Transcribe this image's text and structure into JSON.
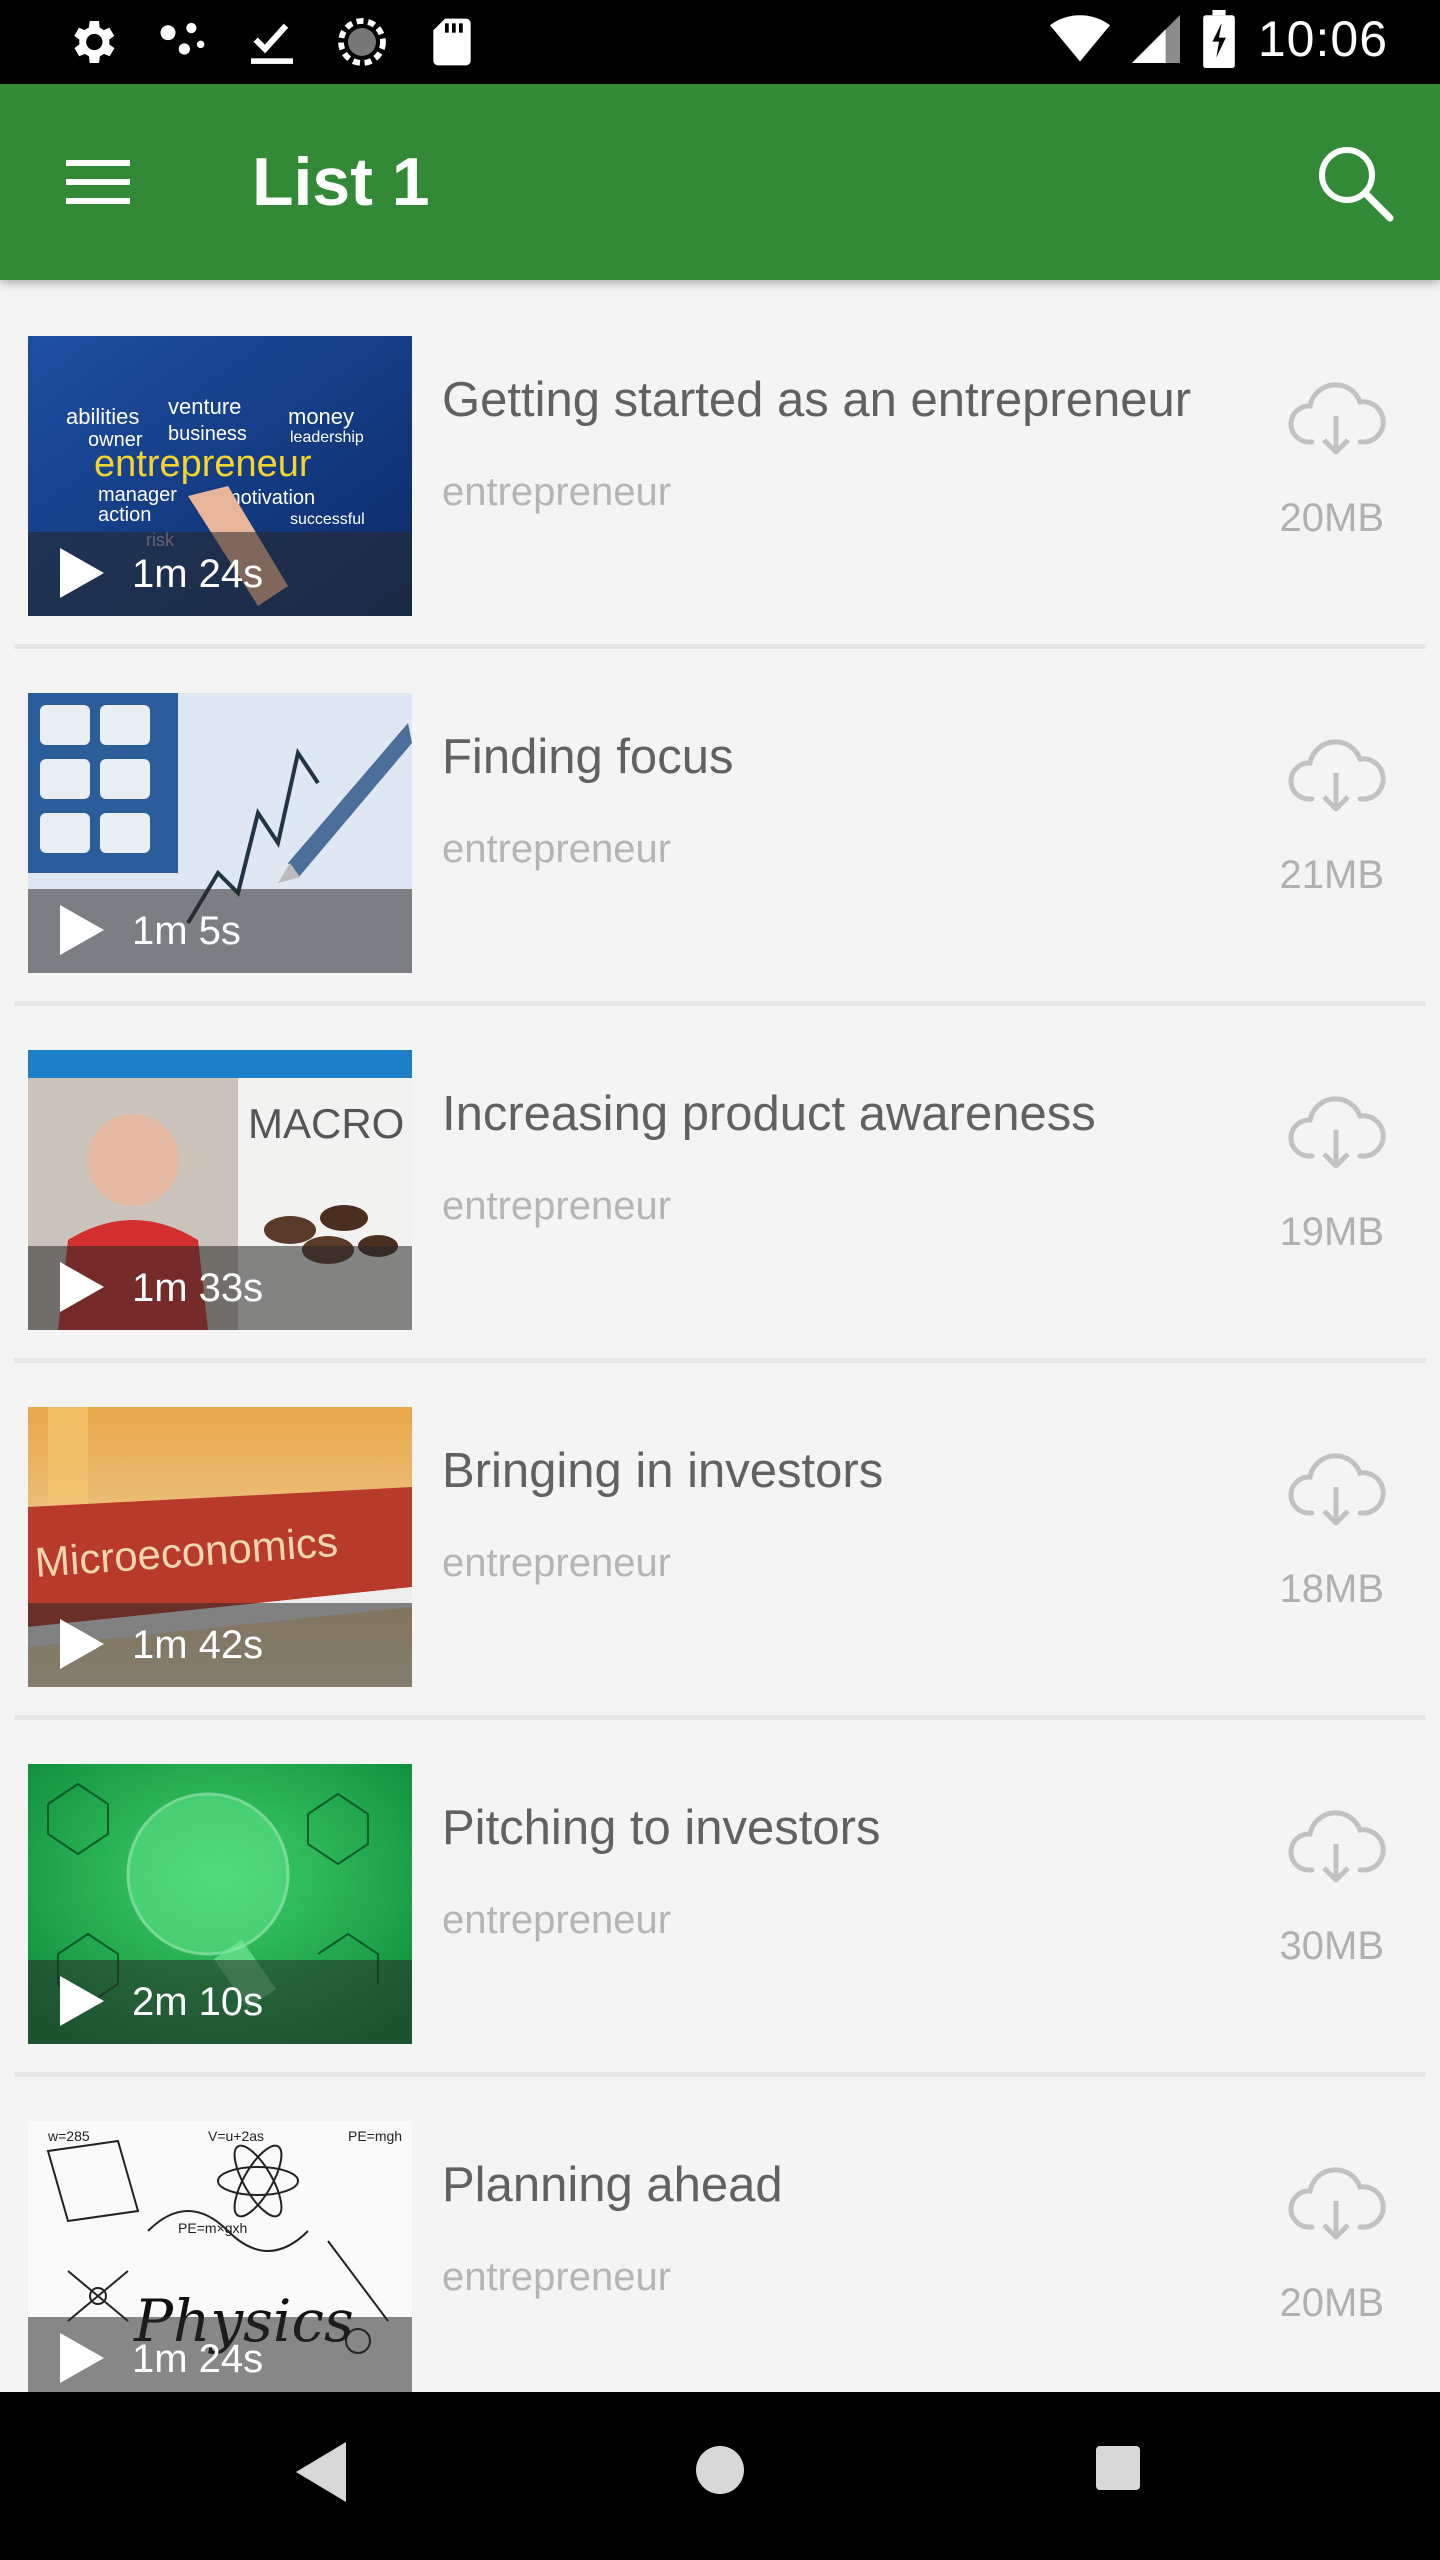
{
  "status_bar": {
    "time": "10:06",
    "left_icons": [
      "gear-icon",
      "nodes-icon",
      "check-download-icon",
      "spinner-icon",
      "sd-card-icon"
    ],
    "right_icons": [
      "wifi-icon",
      "signal-icon",
      "battery-charging-icon"
    ]
  },
  "app_bar": {
    "title": "List 1",
    "menu_icon": "hamburger-menu-icon",
    "search_icon": "search-icon",
    "color": "#338a36"
  },
  "items": [
    {
      "title": "Getting started as an entrepreneur",
      "subtitle": "entrepreneur",
      "duration": "1m 24s",
      "size": "20MB",
      "thumb": "entrepreneur-words"
    },
    {
      "title": "Finding focus",
      "subtitle": "entrepreneur",
      "duration": "1m 5s",
      "size": "21MB",
      "thumb": "calculator-chart"
    },
    {
      "title": "Increasing product awareness",
      "subtitle": "entrepreneur",
      "duration": "1m 33s",
      "size": "19MB",
      "thumb": "macro-lecture",
      "thumb_text": "MACRO"
    },
    {
      "title": "Bringing in investors",
      "subtitle": "entrepreneur",
      "duration": "1m 42s",
      "size": "18MB",
      "thumb": "microeconomics-book",
      "thumb_text": "Microeconomics"
    },
    {
      "title": "Pitching to investors",
      "subtitle": "entrepreneur",
      "duration": "2m 10s",
      "size": "30MB",
      "thumb": "chemistry-flask"
    },
    {
      "title": "Planning ahead",
      "subtitle": "entrepreneur",
      "duration": "1m 24s",
      "size": "20MB",
      "thumb": "physics-doodles",
      "thumb_text": "Physics"
    }
  ],
  "nav_bar": {
    "icons": [
      "back-triangle-icon",
      "home-circle-icon",
      "recents-square-icon"
    ]
  }
}
